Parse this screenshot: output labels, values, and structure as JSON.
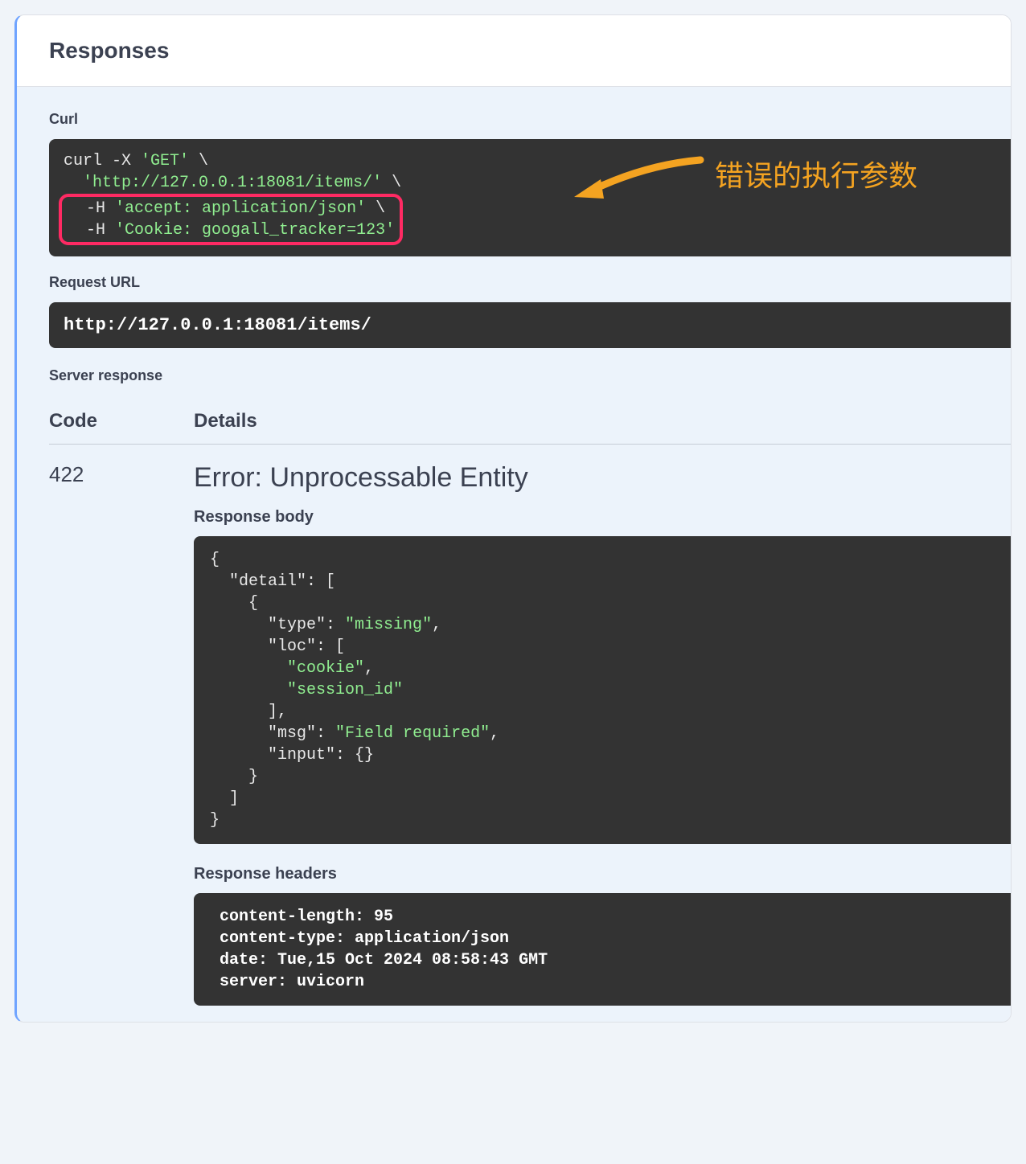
{
  "header": {
    "title": "Responses"
  },
  "curl": {
    "label": "Curl",
    "line1_a": "curl -X ",
    "line1_b": "'GET'",
    "line1_c": " \\",
    "line2_a": "  ",
    "line2_b": "'http://127.0.0.1:18081/items/'",
    "line2_c": " \\",
    "line3_a": "  -H ",
    "line3_b": "'accept: application/json'",
    "line3_c": " \\",
    "line4_a": "  -H ",
    "line4_b": "'Cookie: googall_tracker=123'"
  },
  "annotation": {
    "text": "错误的执行参数"
  },
  "request_url": {
    "label": "Request URL",
    "value": "http://127.0.0.1:18081/items/"
  },
  "server_response": {
    "label": "Server response",
    "columns": {
      "code": "Code",
      "details": "Details"
    },
    "code": "422",
    "error_title": "Error: Unprocessable Entity",
    "body_label": "Response body",
    "body": {
      "l1": "{",
      "l2a": "  ",
      "l2b": "\"detail\"",
      "l2c": ": [",
      "l3": "    {",
      "l4a": "      ",
      "l4b": "\"type\"",
      "l4c": ": ",
      "l4d": "\"missing\"",
      "l4e": ",",
      "l5a": "      ",
      "l5b": "\"loc\"",
      "l5c": ": [",
      "l6a": "        ",
      "l6b": "\"cookie\"",
      "l6c": ",",
      "l7a": "        ",
      "l7b": "\"session_id\"",
      "l8": "      ],",
      "l9a": "      ",
      "l9b": "\"msg\"",
      "l9c": ": ",
      "l9d": "\"Field required\"",
      "l9e": ",",
      "l10a": "      ",
      "l10b": "\"input\"",
      "l10c": ": {}",
      "l11": "    }",
      "l12": "  ]",
      "l13": "}"
    },
    "headers_label": "Response headers",
    "headers": " content-length: 95 \n content-type: application/json \n date: Tue,15 Oct 2024 08:58:43 GMT \n server: uvicorn "
  }
}
